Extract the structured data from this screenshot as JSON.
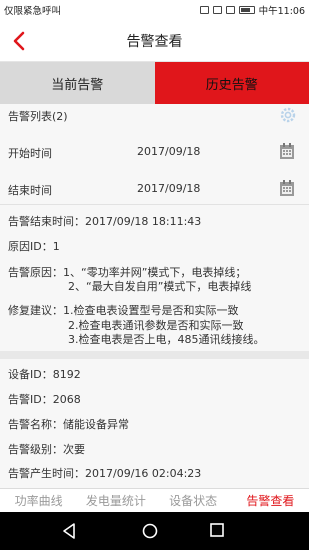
{
  "status_bar": {
    "carrier": "仅限紧急呼叫",
    "time": "中午11:06"
  },
  "header": {
    "title": "告警查看",
    "back_icon": "chevron-left-icon"
  },
  "tabs": [
    {
      "label": "当前告警",
      "active": false
    },
    {
      "label": "历史告警",
      "active": true
    }
  ],
  "list": {
    "heading": "告警列表(2)",
    "settings_icon": "gear-icon"
  },
  "filters": {
    "start_label": "开始时间",
    "start_value": "2017/09/18",
    "end_label": "结束时间",
    "end_value": "2017/09/18",
    "calendar_icon": "calendar-icon"
  },
  "alarm1": {
    "end_time": "告警结束时间：2017/09/18 18:11:43",
    "reason_id": "原因ID：1",
    "reason_line1": "告警原因：1、“零功率并网”模式下，电表掉线；",
    "reason_line2": "2、“最大自发自用”模式下，电表掉线",
    "fix_line1": "修复建议：1.检查电表设置型号是否和实际一致",
    "fix_line2": "2.检查电表通讯参数是否和实际一致",
    "fix_line3": "3.检查电表是否上电，485通讯线接线。"
  },
  "alarm2": {
    "device_id": "设备ID：8192",
    "alarm_id": "告警ID：2068",
    "alarm_name": "告警名称：储能设备异常",
    "alarm_level": "告警级别：次要",
    "start_time": "告警产生时间：2017/09/16 02:04:23"
  },
  "bottom_nav": [
    {
      "label": "功率曲线",
      "active": false
    },
    {
      "label": "发电量统计",
      "active": false
    },
    {
      "label": "设备状态",
      "active": false
    },
    {
      "label": "告警查看",
      "active": true
    }
  ],
  "colors": {
    "accent": "#e0161b",
    "tab_inactive": "#d9d9d9",
    "content_bg": "#f7f7f7",
    "nav_inactive_text": "#9a9a9a"
  }
}
